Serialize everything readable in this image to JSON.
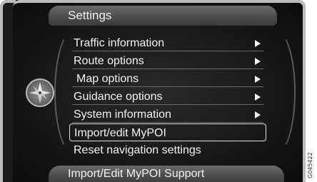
{
  "header": {
    "title": "Settings"
  },
  "menu": {
    "items": [
      {
        "label": "Traffic information",
        "has_submenu": true,
        "selected": false
      },
      {
        "label": "Route options",
        "has_submenu": true,
        "selected": false
      },
      {
        "label": "Map options",
        "has_submenu": true,
        "selected": false
      },
      {
        "label": "Guidance options",
        "has_submenu": true,
        "selected": false
      },
      {
        "label": "System information",
        "has_submenu": true,
        "selected": false
      },
      {
        "label": "Import/edit MyPOI",
        "has_submenu": false,
        "selected": true
      },
      {
        "label": "Reset navigation settings",
        "has_submenu": false,
        "selected": false
      }
    ]
  },
  "footer": {
    "text": "Import/Edit MyPOI Support"
  },
  "figure_code": "G045422",
  "icons": {
    "side": "compass-icon",
    "submenu": "arrow-right-icon"
  }
}
